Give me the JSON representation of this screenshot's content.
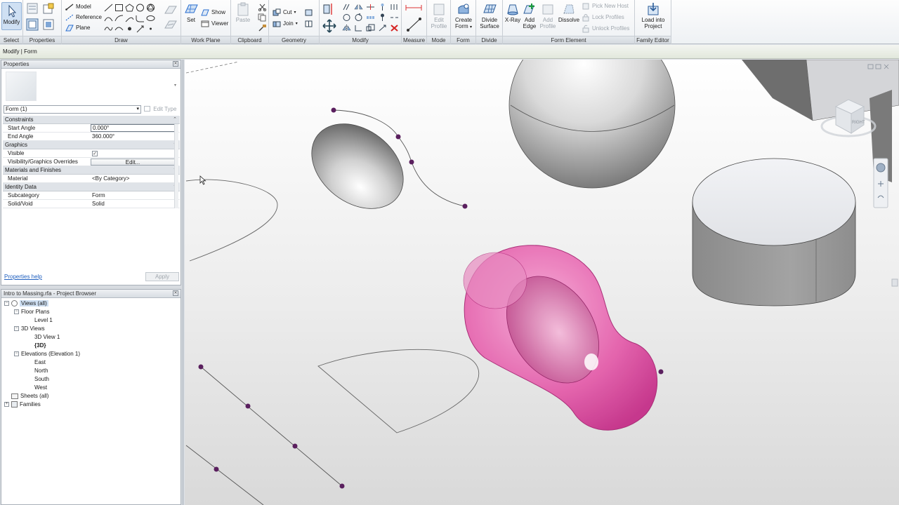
{
  "ribbon": {
    "select": {
      "modify_label": "Modify",
      "panel_label": "Select"
    },
    "properties": {
      "panel_label": "Properties"
    },
    "draw": {
      "panel_label": "Draw",
      "model_label": "Model",
      "reference_label": "Reference",
      "plane_label": "Plane"
    },
    "work_plane": {
      "panel_label": "Work Plane",
      "set_label": "Set",
      "show_label": "Show",
      "viewer_label": "Viewer"
    },
    "clipboard": {
      "panel_label": "Clipboard",
      "paste_label": "Paste"
    },
    "geometry": {
      "panel_label": "Geometry",
      "cut_label": "Cut",
      "join_label": "Join"
    },
    "modify": {
      "panel_label": "Modify"
    },
    "measure": {
      "panel_label": "Measure"
    },
    "mode": {
      "panel_label": "Mode",
      "edit_profile_label": "Edit Profile"
    },
    "form": {
      "panel_label": "Form",
      "create_form_label": "Create Form"
    },
    "divide": {
      "panel_label": "Divide",
      "divide_surface_label": "Divide Surface"
    },
    "form_element": {
      "panel_label": "Form Element",
      "xray_label": "X-Ray",
      "add_edge_label": "Add Edge",
      "add_profile_label": "Add Profile",
      "dissolve_label": "Dissolve",
      "pick_new_host_label": "Pick New Host",
      "lock_profiles_label": "Lock Profiles",
      "unlock_profiles_label": "Unlock Profiles"
    },
    "family_editor": {
      "panel_label": "Family Editor",
      "load_label": "Load into Project"
    }
  },
  "options_bar": {
    "text": "Modify | Form"
  },
  "properties_palette": {
    "title": "Properties",
    "type_selector": "Form (1)",
    "edit_type_label": "Edit Type",
    "groups": {
      "constraints": "Constraints",
      "graphics": "Graphics",
      "materials": "Materials and Finishes",
      "identity": "Identity Data"
    },
    "rows": {
      "start_angle": {
        "name": "Start Angle",
        "value": "0.000°"
      },
      "end_angle": {
        "name": "End Angle",
        "value": "360.000°"
      },
      "visible": {
        "name": "Visible",
        "value": "✓"
      },
      "vg_overrides": {
        "name": "Visibility/Graphics Overrides",
        "value": "Edit..."
      },
      "material": {
        "name": "Material",
        "value": "<By Category>"
      },
      "subcategory": {
        "name": "Subcategory",
        "value": "Form"
      },
      "solid_void": {
        "name": "Solid/Void",
        "value": "Solid"
      }
    },
    "help_link": "Properties help",
    "apply_label": "Apply"
  },
  "project_browser": {
    "title": "Intro to Massing.rfa - Project Browser",
    "views_all": "Views (all)",
    "floor_plans": "Floor Plans",
    "level_1": "Level 1",
    "views_3d": "3D Views",
    "view_3d_1": "3D View 1",
    "view_3d": "{3D}",
    "elevations": "Elevations (Elevation 1)",
    "east": "East",
    "north": "North",
    "south": "South",
    "west": "West",
    "sheets_all": "Sheets (all)",
    "families": "Families"
  },
  "viewcube": {
    "face_label": "RIGHT"
  },
  "colors": {
    "ribbon_bg": "#f3f5f7",
    "form_pink": "#e23a9a",
    "control_point": "#5a1f5e",
    "panel_bg": "#ffffff"
  }
}
